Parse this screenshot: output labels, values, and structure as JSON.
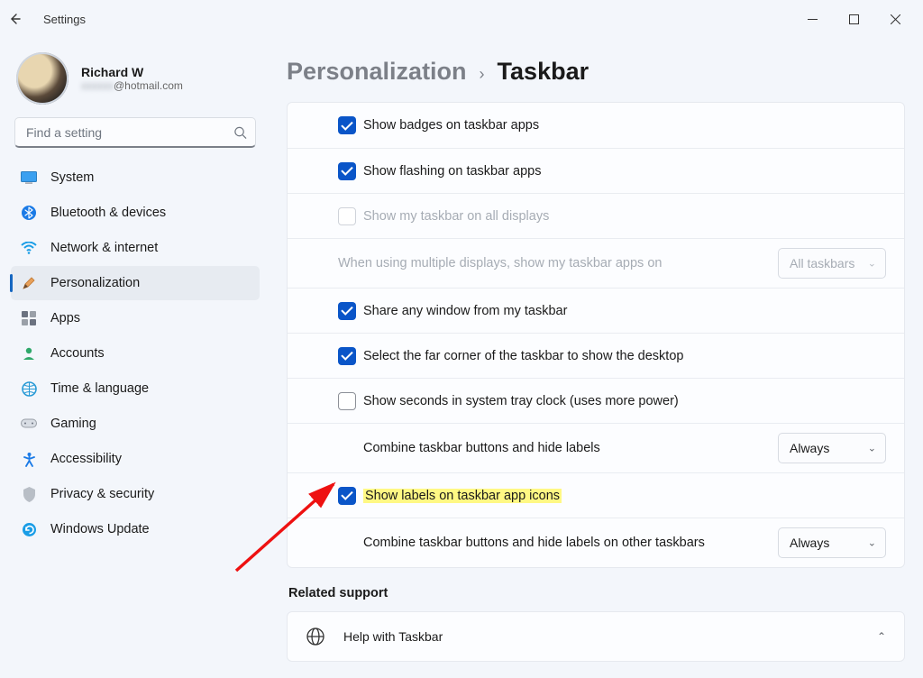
{
  "window": {
    "title": "Settings"
  },
  "user": {
    "name": "Richard W",
    "email_domain": "@hotmail.com"
  },
  "search": {
    "placeholder": "Find a setting"
  },
  "nav": {
    "items": [
      {
        "label": "System"
      },
      {
        "label": "Bluetooth & devices"
      },
      {
        "label": "Network & internet"
      },
      {
        "label": "Personalization"
      },
      {
        "label": "Apps"
      },
      {
        "label": "Accounts"
      },
      {
        "label": "Time & language"
      },
      {
        "label": "Gaming"
      },
      {
        "label": "Accessibility"
      },
      {
        "label": "Privacy & security"
      },
      {
        "label": "Windows Update"
      }
    ]
  },
  "breadcrumb": {
    "parent": "Personalization",
    "current": "Taskbar"
  },
  "settings": {
    "show_badges": {
      "label": "Show badges on taskbar apps",
      "checked": true
    },
    "show_flashing": {
      "label": "Show flashing on taskbar apps",
      "checked": true
    },
    "all_displays": {
      "label": "Show my taskbar on all displays",
      "checked": false,
      "disabled": true
    },
    "multi_display_apps": {
      "label": "When using multiple displays, show my taskbar apps on",
      "value": "All taskbars",
      "disabled": true
    },
    "share_window": {
      "label": "Share any window from my taskbar",
      "checked": true
    },
    "far_corner": {
      "label": "Select the far corner of the taskbar to show the desktop",
      "checked": true
    },
    "show_seconds": {
      "label": "Show seconds in system tray clock (uses more power)",
      "checked": false
    },
    "combine_main": {
      "label": "Combine taskbar buttons and hide labels",
      "value": "Always"
    },
    "show_labels": {
      "label": "Show labels on taskbar app icons",
      "checked": true,
      "highlighted": true
    },
    "combine_other": {
      "label": "Combine taskbar buttons and hide labels on other taskbars",
      "value": "Always"
    }
  },
  "related": {
    "title": "Related support",
    "help_label": "Help with Taskbar"
  }
}
